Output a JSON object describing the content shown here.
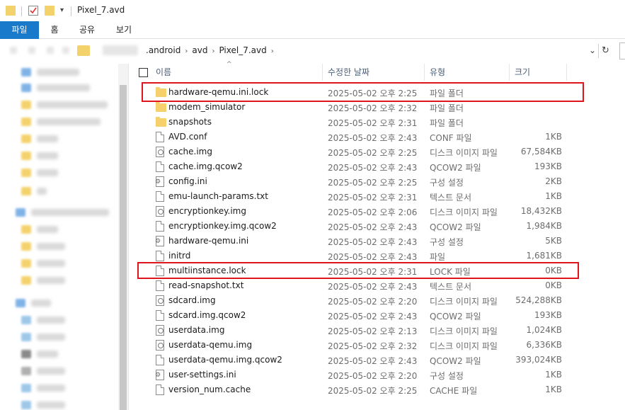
{
  "window": {
    "title": "Pixel_7.avd"
  },
  "ribbon": {
    "tabs": [
      "파일",
      "홈",
      "공유",
      "보기"
    ]
  },
  "address": {
    "crumbs": [
      ".android",
      "avd",
      "Pixel_7.avd"
    ]
  },
  "columns": {
    "name": "이름",
    "modified": "수정한 날짜",
    "type": "유형",
    "size": "크기"
  },
  "files": [
    {
      "name": "hardware-qemu.ini.lock",
      "date": "2025-05-02 오후 2:25",
      "type": "파일 폴더",
      "size": "",
      "icon": "folder-icon"
    },
    {
      "name": "modem_simulator",
      "date": "2025-05-02 오후 2:32",
      "type": "파일 폴더",
      "size": "",
      "icon": "folder-icon"
    },
    {
      "name": "snapshots",
      "date": "2025-05-02 오후 2:31",
      "type": "파일 폴더",
      "size": "",
      "icon": "folder-icon"
    },
    {
      "name": "AVD.conf",
      "date": "2025-05-02 오후 2:43",
      "type": "CONF 파일",
      "size": "1KB",
      "icon": "document-icon"
    },
    {
      "name": "cache.img",
      "date": "2025-05-02 오후 2:25",
      "type": "디스크 이미지 파일",
      "size": "67,584KB",
      "icon": "disc-image-icon"
    },
    {
      "name": "cache.img.qcow2",
      "date": "2025-05-02 오후 2:43",
      "type": "QCOW2 파일",
      "size": "193KB",
      "icon": "document-icon"
    },
    {
      "name": "config.ini",
      "date": "2025-05-02 오후 2:25",
      "type": "구성 설정",
      "size": "2KB",
      "icon": "settings-file-icon"
    },
    {
      "name": "emu-launch-params.txt",
      "date": "2025-05-02 오후 2:31",
      "type": "텍스트 문서",
      "size": "1KB",
      "icon": "document-icon"
    },
    {
      "name": "encryptionkey.img",
      "date": "2025-05-02 오후 2:06",
      "type": "디스크 이미지 파일",
      "size": "18,432KB",
      "icon": "disc-image-icon"
    },
    {
      "name": "encryptionkey.img.qcow2",
      "date": "2025-05-02 오후 2:43",
      "type": "QCOW2 파일",
      "size": "1,984KB",
      "icon": "document-icon"
    },
    {
      "name": "hardware-qemu.ini",
      "date": "2025-05-02 오후 2:43",
      "type": "구성 설정",
      "size": "5KB",
      "icon": "settings-file-icon"
    },
    {
      "name": "initrd",
      "date": "2025-05-02 오후 2:43",
      "type": "파일",
      "size": "1,681KB",
      "icon": "document-icon"
    },
    {
      "name": "multiinstance.lock",
      "date": "2025-05-02 오후 2:31",
      "type": "LOCK 파일",
      "size": "0KB",
      "icon": "document-icon"
    },
    {
      "name": "read-snapshot.txt",
      "date": "2025-05-02 오후 2:43",
      "type": "텍스트 문서",
      "size": "0KB",
      "icon": "document-icon"
    },
    {
      "name": "sdcard.img",
      "date": "2025-05-02 오후 2:20",
      "type": "디스크 이미지 파일",
      "size": "524,288KB",
      "icon": "disc-image-icon"
    },
    {
      "name": "sdcard.img.qcow2",
      "date": "2025-05-02 오후 2:43",
      "type": "QCOW2 파일",
      "size": "193KB",
      "icon": "document-icon"
    },
    {
      "name": "userdata.img",
      "date": "2025-05-02 오후 2:13",
      "type": "디스크 이미지 파일",
      "size": "1,024KB",
      "icon": "disc-image-icon"
    },
    {
      "name": "userdata-qemu.img",
      "date": "2025-05-02 오후 2:32",
      "type": "디스크 이미지 파일",
      "size": "6,336KB",
      "icon": "disc-image-icon"
    },
    {
      "name": "userdata-qemu.img.qcow2",
      "date": "2025-05-02 오후 2:43",
      "type": "QCOW2 파일",
      "size": "393,024KB",
      "icon": "document-icon"
    },
    {
      "name": "user-settings.ini",
      "date": "2025-05-02 오후 2:20",
      "type": "구성 설정",
      "size": "1KB",
      "icon": "settings-file-icon"
    },
    {
      "name": "version_num.cache",
      "date": "2025-05-02 오후 2:25",
      "type": "CACHE 파일",
      "size": "1KB",
      "icon": "document-icon"
    }
  ],
  "annotations": {
    "highlight_color": "#e0141d",
    "highlighted_items": [
      "hardware-qemu.ini.lock",
      "multiinstance.lock"
    ]
  },
  "colors": {
    "ribbon_file_tab": "#1979ca",
    "folder": "#f6d06a",
    "header_text": "#4c607a"
  }
}
